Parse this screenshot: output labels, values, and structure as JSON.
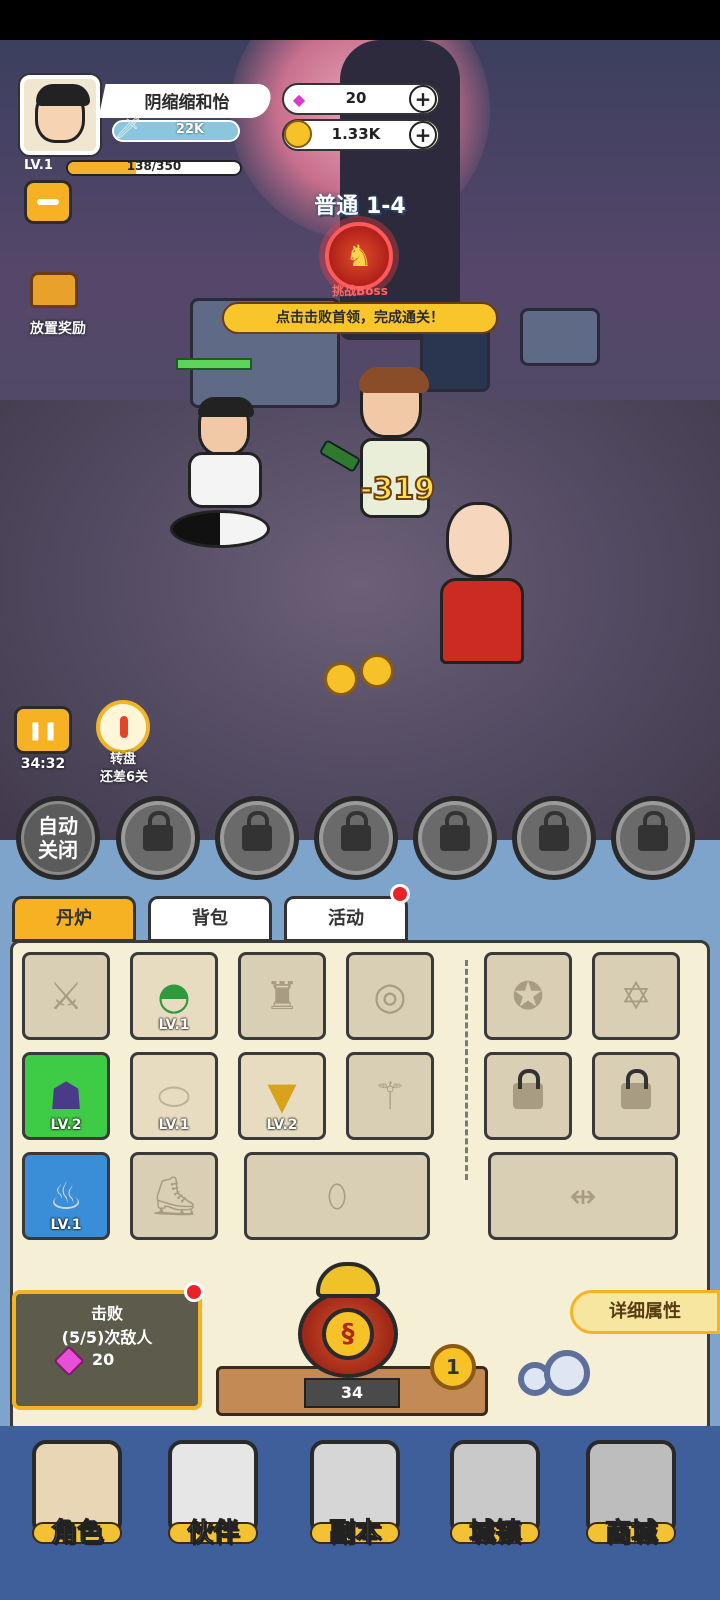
{
  "player": {
    "name": "阴缩缩和怡",
    "power": "22K",
    "level": "LV.1",
    "xp_text": "138/350",
    "xp_fraction": 0.394
  },
  "currency": {
    "gems": "20",
    "coins": "1.33K"
  },
  "idle_reward_label": "放置奖励",
  "stage": {
    "title": "普通 1-4",
    "boss_label": "挑战Boss",
    "hint": "点击击败首领，完成通关！"
  },
  "battle": {
    "damage": "-319"
  },
  "controls": {
    "timer": "34:32",
    "wheel_title": "转盘",
    "wheel_sub": "还差6关",
    "auto_line1": "自动",
    "auto_line2": "关闭"
  },
  "tabs": [
    {
      "label": "丹炉",
      "active": true
    },
    {
      "label": "背包",
      "active": false
    },
    {
      "label": "活动",
      "active": false,
      "badge": true
    }
  ],
  "inventory": {
    "slot_helmet_lvl": "LV.1",
    "slot_pet_lvl": "LV.2",
    "slot_plate_lvl": "LV.1",
    "slot_necklace_lvl": "LV.2",
    "slot_bucket_lvl": "LV.1"
  },
  "quest": {
    "line1": "击败",
    "line2": "(5/5)次敌人",
    "reward": "20"
  },
  "furnace": {
    "level_num": "34",
    "badge": "1"
  },
  "detail_button": "详细属性",
  "nav": [
    {
      "label": "角色",
      "icon": "character-icon"
    },
    {
      "label": "伙伴",
      "icon": "partner-icon"
    },
    {
      "label": "副本",
      "icon": "dungeon-icon"
    },
    {
      "label": "城镇",
      "icon": "town-icon"
    },
    {
      "label": "商城",
      "icon": "shop-icon"
    }
  ]
}
